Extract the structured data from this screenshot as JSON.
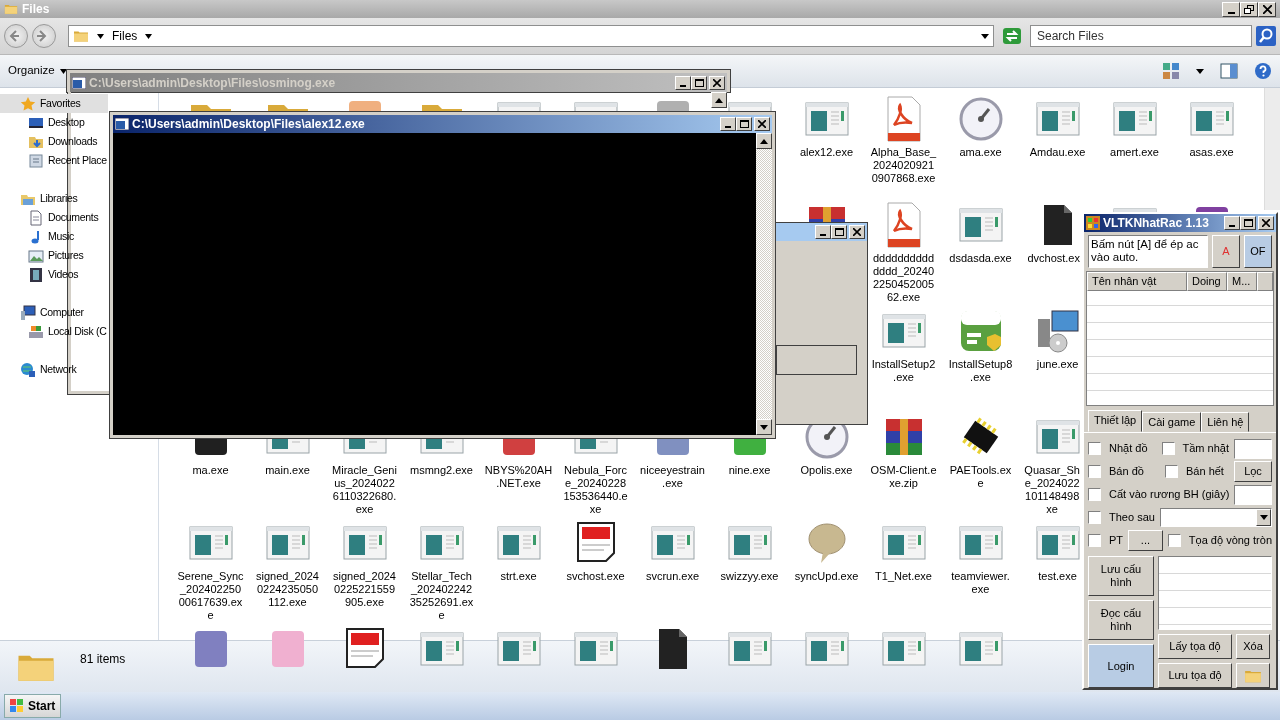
{
  "explorer": {
    "title": "Files",
    "address": "Files",
    "search": {
      "placeholder": "Search Files"
    },
    "organize": "Organize",
    "nav": [
      {
        "label": "Favorites",
        "kind": "favorites",
        "selected": true,
        "children": [
          {
            "label": "Desktop",
            "kind": "desktop",
            "selected": false
          },
          {
            "label": "Downloads",
            "kind": "downloads",
            "selected": false
          },
          {
            "label": "Recent Place",
            "kind": "recent",
            "selected": false
          }
        ]
      },
      {
        "label": "Libraries",
        "kind": "libraries",
        "selected": false,
        "children": [
          {
            "label": "Documents",
            "kind": "documents",
            "selected": false
          },
          {
            "label": "Music",
            "kind": "music",
            "selected": false
          },
          {
            "label": "Pictures",
            "kind": "pictures",
            "selected": false
          },
          {
            "label": "Videos",
            "kind": "videos",
            "selected": false
          }
        ]
      },
      {
        "label": "Computer",
        "kind": "computer",
        "selected": false,
        "children": [
          {
            "label": "Local Disk (C",
            "kind": "disk",
            "selected": false
          }
        ]
      },
      {
        "label": "Network",
        "kind": "network",
        "selected": false
      }
    ],
    "files": [
      [
        {
          "kind": "folder"
        },
        {
          "kind": "folder"
        },
        {
          "kind": "app",
          "color": "#f0b080"
        },
        {
          "kind": "folder"
        },
        {
          "kind": "exe"
        },
        {
          "kind": "exe"
        },
        {
          "kind": "app",
          "color": "#b0b0b0"
        },
        {
          "kind": "exe"
        },
        {
          "kind": "exe",
          "lines": [
            "alex12.exe"
          ]
        },
        {
          "kind": "pdf",
          "lines": [
            "Alpha_Base_",
            "2024020921",
            "0907868.exe"
          ]
        },
        {
          "kind": "gauge",
          "lines": [
            "ama.exe"
          ]
        },
        {
          "kind": "exe",
          "lines": [
            "Amdau.exe"
          ]
        },
        {
          "kind": "exe",
          "lines": [
            "amert.exe"
          ]
        },
        {
          "kind": "exe",
          "lines": [
            "asas.exe"
          ]
        }
      ],
      [
        {
          "kind": "covered"
        },
        {
          "kind": "covered"
        },
        {
          "kind": "covered"
        },
        {
          "kind": "covered"
        },
        {
          "kind": "covered"
        },
        {
          "kind": "covered"
        },
        {
          "kind": "covered"
        },
        {
          "kind": "covered"
        },
        {
          "kind": "zip"
        },
        {
          "kind": "pdf",
          "lines": [
            "dddddddddd",
            "dddd_20240",
            "2250452005",
            "62.exe"
          ]
        },
        {
          "kind": "exe",
          "lines": [
            "dsdasda.exe"
          ]
        },
        {
          "kind": "png",
          "lines": [
            "dvchost.ex"
          ]
        },
        {
          "kind": "exe"
        },
        {
          "kind": "app",
          "color": "#8040a0"
        }
      ],
      [
        {
          "kind": "covered"
        },
        {
          "kind": "covered"
        },
        {
          "kind": "covered"
        },
        {
          "kind": "covered"
        },
        {
          "kind": "covered"
        },
        {
          "kind": "covered"
        },
        {
          "kind": "covered"
        },
        {
          "kind": "covered"
        },
        {
          "kind": "covered"
        },
        {
          "kind": "exe",
          "lines": [
            "InstallSetup2",
            ".exe"
          ]
        },
        {
          "kind": "amazon",
          "lines": [
            "InstallSetup8",
            ".exe"
          ]
        },
        {
          "kind": "setup",
          "lines": [
            "june.exe"
          ]
        }
      ],
      [
        {
          "kind": "app",
          "color": "#202020",
          "lines": [
            "ma.exe"
          ]
        },
        {
          "kind": "exe",
          "lines": [
            "main.exe"
          ]
        },
        {
          "kind": "exe",
          "lines": [
            "Miracle_Geni",
            "us_2024022",
            "6110322680.",
            "exe"
          ]
        },
        {
          "kind": "exe",
          "lines": [
            "msmng2.exe"
          ]
        },
        {
          "kind": "app",
          "color": "#d04040",
          "lines": [
            "NBYS%20AH",
            ".NET.exe"
          ]
        },
        {
          "kind": "exe",
          "lines": [
            "Nebula_Forc",
            "e_20240228",
            "153536440.e",
            "xe"
          ]
        },
        {
          "kind": "app",
          "color": "#8090c0",
          "lines": [
            "niceeyestrain",
            ".exe"
          ]
        },
        {
          "kind": "app",
          "color": "#40b040",
          "lines": [
            "nine.exe"
          ]
        },
        {
          "kind": "gauge",
          "lines": [
            "Opolis.exe"
          ]
        },
        {
          "kind": "zip",
          "lines": [
            "OSM-Client.e",
            "xe.zip"
          ]
        },
        {
          "kind": "chip",
          "lines": [
            "PAETools.ex",
            "e"
          ]
        },
        {
          "kind": "exe",
          "lines": [
            "Quasar_Sh",
            "e_2024022",
            "101148498",
            "xe"
          ]
        }
      ],
      [
        {
          "kind": "exe",
          "lines": [
            "Serene_Sync",
            "_202402250",
            "00617639.ex",
            "e"
          ]
        },
        {
          "kind": "exe",
          "lines": [
            "signed_2024",
            "0224235050",
            "112.exe"
          ]
        },
        {
          "kind": "exe",
          "lines": [
            "signed_2024",
            "0225221559",
            "905.exe"
          ]
        },
        {
          "kind": "exe",
          "lines": [
            "Stellar_Tech",
            "_202402242",
            "35252691.ex",
            "e"
          ]
        },
        {
          "kind": "exe",
          "lines": [
            "strt.exe"
          ]
        },
        {
          "kind": "doc",
          "lines": [
            "svchost.exe"
          ]
        },
        {
          "kind": "exe",
          "lines": [
            "svcrun.exe"
          ]
        },
        {
          "kind": "exe",
          "lines": [
            "swizzyy.exe"
          ]
        },
        {
          "kind": "bubble",
          "lines": [
            "syncUpd.exe"
          ]
        },
        {
          "kind": "exe",
          "lines": [
            "T1_Net.exe"
          ]
        },
        {
          "kind": "exe",
          "lines": [
            "teamviewer.",
            "exe"
          ]
        },
        {
          "kind": "exe",
          "lines": [
            "test.exe"
          ]
        }
      ],
      [
        {
          "kind": "app",
          "color": "#8080c0"
        },
        {
          "kind": "app",
          "color": "#f0b0d0"
        },
        {
          "kind": "doc"
        },
        {
          "kind": "exe"
        },
        {
          "kind": "exe"
        },
        {
          "kind": "exe"
        },
        {
          "kind": "png"
        },
        {
          "kind": "exe"
        },
        {
          "kind": "exe"
        },
        {
          "kind": "exe"
        },
        {
          "kind": "exe"
        }
      ]
    ],
    "status": "81 items"
  },
  "windows": [
    {
      "kind": "console",
      "title": "C:\\Users\\admin\\Desktop\\Files\\osminog.exe",
      "active": false
    },
    {
      "kind": "console",
      "title": "C:\\Users\\admin\\Desktop\\Files\\alex12.exe",
      "active": true
    },
    {
      "kind": "dialog"
    }
  ],
  "tool": {
    "title": "VLTKNhatRac 1.13",
    "message": "Bấm nút [A] để ép ac vào auto.",
    "top_buttons": [
      "A",
      "OF"
    ],
    "columns": [
      "Tên nhân vật",
      "Doing",
      "M..."
    ],
    "tabs": [
      {
        "label": "Thiết lập",
        "selected": true
      },
      {
        "label": "Cài game",
        "selected": false
      },
      {
        "label": "Liên hệ",
        "selected": false
      }
    ],
    "option_rows": [
      [
        {
          "kind": "check",
          "label": "Nhặt đồ",
          "checked": false
        },
        {
          "kind": "check",
          "label": "Tầm nhặt",
          "checked": false
        },
        {
          "kind": "field"
        }
      ],
      [
        {
          "kind": "check",
          "label": "Bán đồ",
          "checked": false
        },
        {
          "kind": "check",
          "label": "Bán hết",
          "checked": false
        },
        {
          "kind": "button",
          "label": "Lọc"
        }
      ],
      [
        {
          "kind": "check",
          "label": "Cất vào rương BH (giây)",
          "checked": false
        },
        {
          "kind": "field"
        }
      ],
      [
        {
          "kind": "check",
          "label": "Theo sau",
          "checked": false
        },
        {
          "kind": "select"
        }
      ],
      [
        {
          "kind": "check",
          "label": "PT",
          "checked": false
        },
        {
          "kind": "button",
          "label": "..."
        },
        {
          "kind": "check",
          "label": "Tọa độ vòng tròn",
          "checked": false
        }
      ]
    ],
    "side_buttons": [
      {
        "label": "Lưu cấu hình",
        "hovered": false
      },
      {
        "label": "Đọc cấu hình",
        "hovered": false
      },
      {
        "label": "Login",
        "hovered": true
      }
    ],
    "coord_buttons": [
      {
        "kind": "text",
        "label": "Lấy tọa độ"
      },
      {
        "kind": "text",
        "label": "Xóa"
      },
      {
        "kind": "text",
        "label": "Lưu tọa độ"
      },
      {
        "kind": "folder"
      }
    ]
  },
  "taskbar": {
    "start": "Start"
  }
}
